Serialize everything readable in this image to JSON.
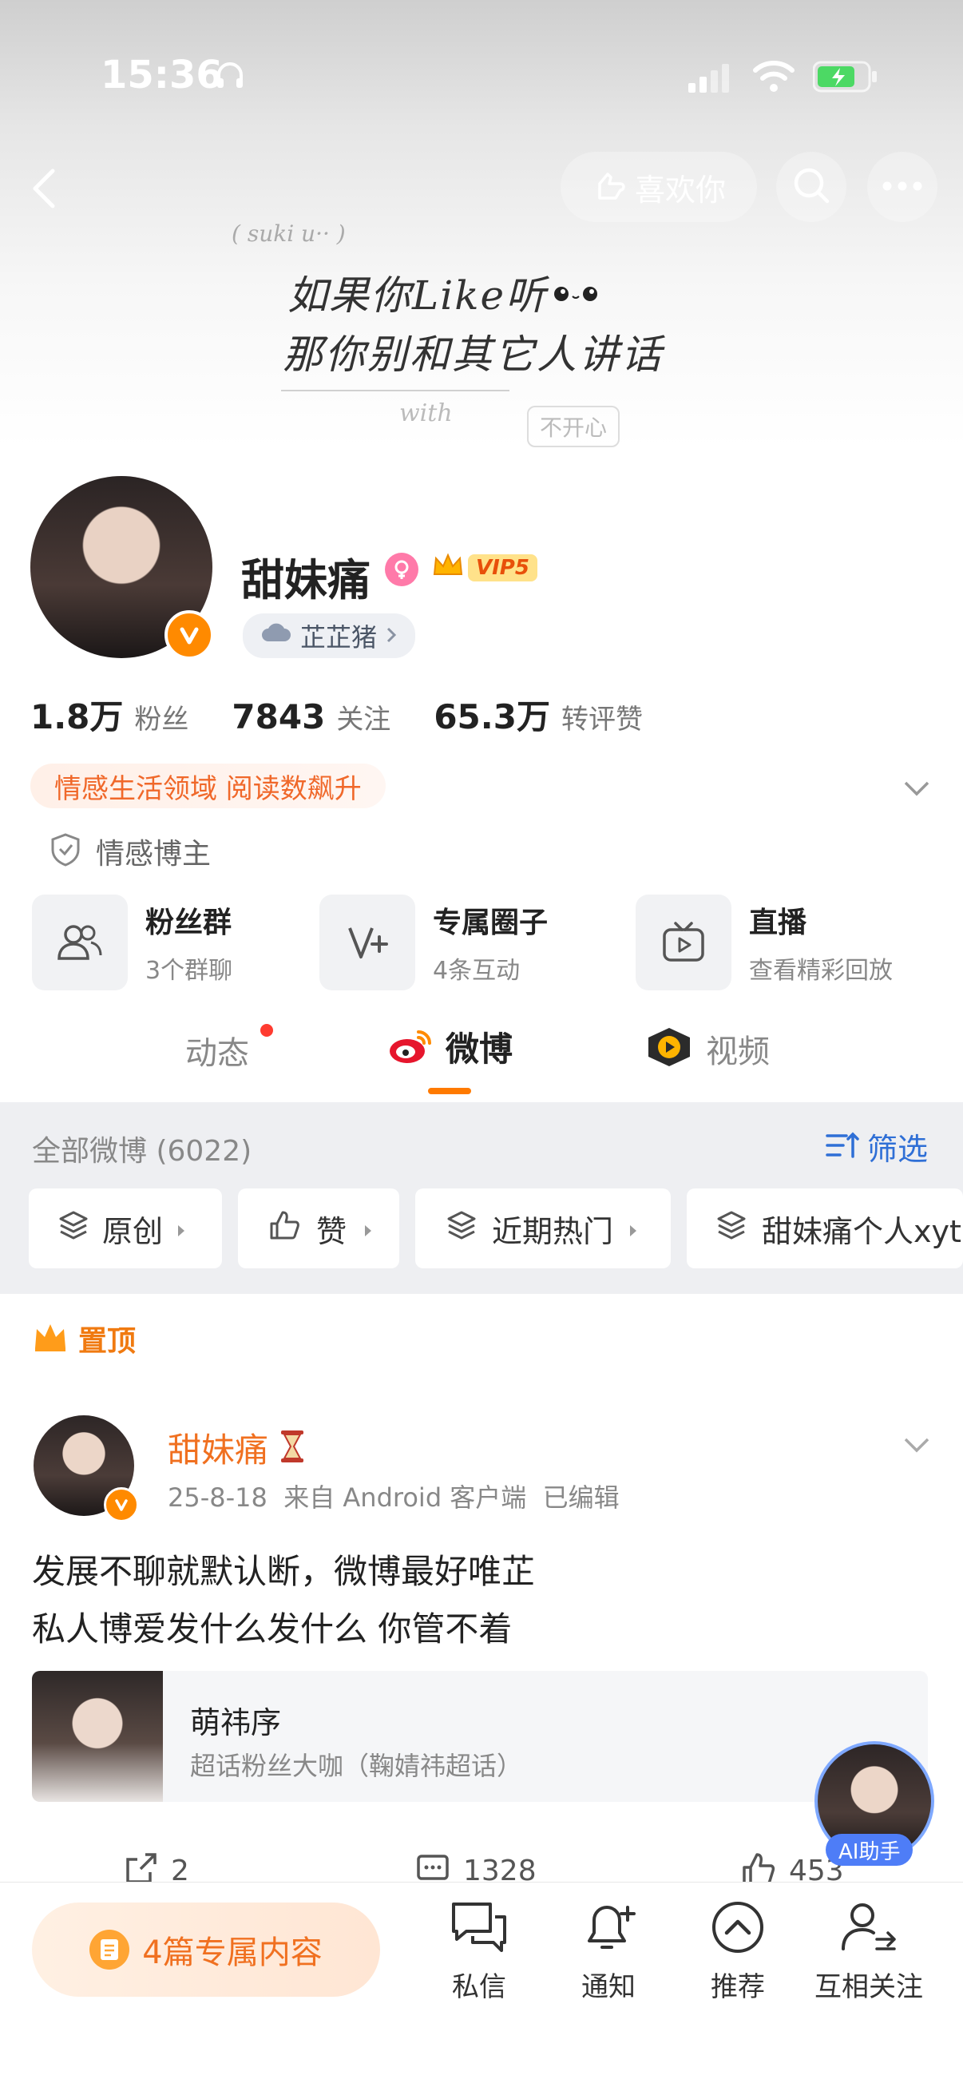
{
  "status": {
    "time": "15:36"
  },
  "header": {
    "like_label": "喜欢你",
    "cover_line1": "如果你Like听 ",
    "cover_line2": "那你别和其它人讲话",
    "cover_small1": "( suki u·· )",
    "cover_small2": "with",
    "cover_small3": "不开心"
  },
  "profile": {
    "name": "甜妹痛",
    "vip": "VIP5",
    "group_tag": "芷芷猪",
    "stats": [
      {
        "value": "1.8万",
        "label": "粉丝"
      },
      {
        "value": "7843",
        "label": "关注"
      },
      {
        "value": "65.3万",
        "label": "转评赞"
      }
    ],
    "highlight": "情感生活领域 阅读数飙升",
    "category": "情感博主"
  },
  "tiles": [
    {
      "title": "粉丝群",
      "sub": "3个群聊"
    },
    {
      "title": "专属圈子",
      "sub": "4条互动"
    },
    {
      "title": "直播",
      "sub": "查看精彩回放"
    }
  ],
  "tabs": [
    "动态",
    "微博",
    "视频"
  ],
  "list": {
    "count_label": "全部微博 (6022)",
    "filter_label": "筛选",
    "chips": [
      "原创",
      "赞",
      "近期热门",
      "甜妹痛个人xyt"
    ]
  },
  "pinned_label": "置顶",
  "post": {
    "author": "甜妹痛",
    "meta": "25-8-18  来自 Android 客户端  已编辑",
    "line1": "发展不聊就默认断，微博最好唯芷",
    "line2": "私人博爱发什么发什么 你管不着",
    "card_title": "萌祎序",
    "card_sub": "超话粉丝大咖（鞠婧祎超话）",
    "reposts": "2",
    "comments": "1328",
    "likes": "453"
  },
  "ai_label": "AI助手",
  "bottom": {
    "exclusive": "4篇专属内容",
    "nav": [
      "私信",
      "通知",
      "推荐",
      "互相关注"
    ]
  },
  "colors": {
    "accent": "#ff7a00",
    "orange_text": "#f07020",
    "blue": "#2f6fd6",
    "gray_band": "#eeeff2"
  }
}
